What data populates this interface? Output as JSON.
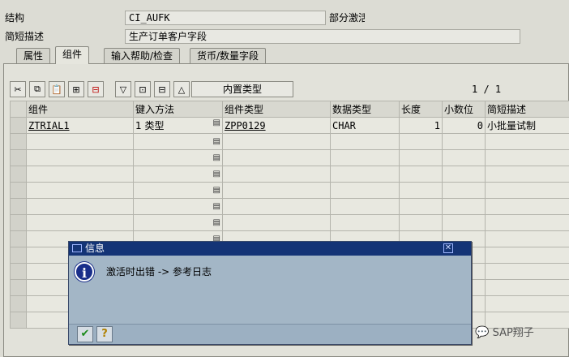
{
  "header": {
    "structure_label": "结构",
    "structure_value": "CI_AUFK",
    "status_text": "部分激活",
    "short_desc_label": "简短描述",
    "short_desc_value": "生产订单客户字段"
  },
  "tabs": [
    {
      "label": "属性"
    },
    {
      "label": "组件"
    },
    {
      "label": "输入帮助/检查"
    },
    {
      "label": "货币/数量字段"
    }
  ],
  "toolbar": {
    "builtin_type_label": "内置类型",
    "page_indicator": "1 / 1"
  },
  "table": {
    "columns": [
      "组件",
      "键入方法",
      "组件类型",
      "数据类型",
      "长度",
      "小数位",
      "简短描述"
    ],
    "rows": [
      {
        "component": "ZTRIAL1",
        "typing_method": "1 类型",
        "component_type": "ZPP0129",
        "data_type": "CHAR",
        "length": "1",
        "decimals": "0",
        "short_desc": "小批量试制"
      }
    ]
  },
  "dialog": {
    "title": "信息",
    "message": "激活时出错 -> 参考日志"
  },
  "watermark": "SAP翔子",
  "colors": {
    "background": "#dcdcd4",
    "dialog_title": "#143476",
    "dialog_body": "#a3b6c6"
  }
}
